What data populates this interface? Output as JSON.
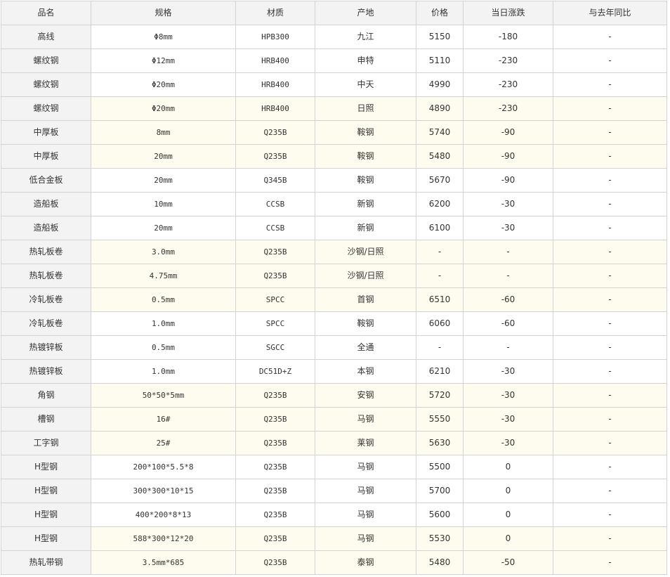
{
  "columns": [
    "品名",
    "规格",
    "材质",
    "产地",
    "价格",
    "当日涨跌",
    "与去年同比"
  ],
  "rows": [
    {
      "name": "高线",
      "spec": "Φ8mm",
      "material": "HPB300",
      "origin": "九江",
      "price": "5150",
      "change": "-180",
      "yoy": "-",
      "highlight": false
    },
    {
      "name": "螺纹钢",
      "spec": "Φ12mm",
      "material": "HRB400",
      "origin": "申特",
      "price": "5110",
      "change": "-230",
      "yoy": "-",
      "highlight": false
    },
    {
      "name": "螺纹钢",
      "spec": "Φ20mm",
      "material": "HRB400",
      "origin": "中天",
      "price": "4990",
      "change": "-230",
      "yoy": "-",
      "highlight": false
    },
    {
      "name": "螺纹钢",
      "spec": "Φ20mm",
      "material": "HRB400",
      "origin": "日照",
      "price": "4890",
      "change": "-230",
      "yoy": "-",
      "highlight": true
    },
    {
      "name": "中厚板",
      "spec": "8mm",
      "material": "Q235B",
      "origin": "鞍钢",
      "price": "5740",
      "change": "-90",
      "yoy": "-",
      "highlight": true
    },
    {
      "name": "中厚板",
      "spec": "20mm",
      "material": "Q235B",
      "origin": "鞍钢",
      "price": "5480",
      "change": "-90",
      "yoy": "-",
      "highlight": true
    },
    {
      "name": "低合金板",
      "spec": "20mm",
      "material": "Q345B",
      "origin": "鞍钢",
      "price": "5670",
      "change": "-90",
      "yoy": "-",
      "highlight": false
    },
    {
      "name": "造船板",
      "spec": "10mm",
      "material": "CCSB",
      "origin": "新钢",
      "price": "6200",
      "change": "-30",
      "yoy": "-",
      "highlight": false
    },
    {
      "name": "造船板",
      "spec": "20mm",
      "material": "CCSB",
      "origin": "新钢",
      "price": "6100",
      "change": "-30",
      "yoy": "-",
      "highlight": false
    },
    {
      "name": "热轧板卷",
      "spec": "3.0mm",
      "material": "Q235B",
      "origin": "沙钢/日照",
      "price": "-",
      "change": "-",
      "yoy": "-",
      "highlight": true
    },
    {
      "name": "热轧板卷",
      "spec": "4.75mm",
      "material": "Q235B",
      "origin": "沙钢/日照",
      "price": "-",
      "change": "-",
      "yoy": "-",
      "highlight": true
    },
    {
      "name": "冷轧板卷",
      "spec": "0.5mm",
      "material": "SPCC",
      "origin": "首钢",
      "price": "6510",
      "change": "-60",
      "yoy": "-",
      "highlight": true
    },
    {
      "name": "冷轧板卷",
      "spec": "1.0mm",
      "material": "SPCC",
      "origin": "鞍钢",
      "price": "6060",
      "change": "-60",
      "yoy": "-",
      "highlight": false
    },
    {
      "name": "热镀锌板",
      "spec": "0.5mm",
      "material": "SGCC",
      "origin": "全通",
      "price": "-",
      "change": "-",
      "yoy": "-",
      "highlight": false
    },
    {
      "name": "热镀锌板",
      "spec": "1.0mm",
      "material": "DC51D+Z",
      "origin": "本钢",
      "price": "6210",
      "change": "-30",
      "yoy": "-",
      "highlight": false
    },
    {
      "name": "角钢",
      "spec": "50*50*5mm",
      "material": "Q235B",
      "origin": "安钢",
      "price": "5720",
      "change": "-30",
      "yoy": "-",
      "highlight": true
    },
    {
      "name": "槽钢",
      "spec": "16#",
      "material": "Q235B",
      "origin": "马钢",
      "price": "5550",
      "change": "-30",
      "yoy": "-",
      "highlight": true
    },
    {
      "name": "工字钢",
      "spec": "25#",
      "material": "Q235B",
      "origin": "莱钢",
      "price": "5630",
      "change": "-30",
      "yoy": "-",
      "highlight": true
    },
    {
      "name": "H型钢",
      "spec": "200*100*5.5*8",
      "material": "Q235B",
      "origin": "马钢",
      "price": "5500",
      "change": "0",
      "yoy": "-",
      "highlight": false
    },
    {
      "name": "H型钢",
      "spec": "300*300*10*15",
      "material": "Q235B",
      "origin": "马钢",
      "price": "5700",
      "change": "0",
      "yoy": "-",
      "highlight": false
    },
    {
      "name": "H型钢",
      "spec": "400*200*8*13",
      "material": "Q235B",
      "origin": "马钢",
      "price": "5600",
      "change": "0",
      "yoy": "-",
      "highlight": false
    },
    {
      "name": "H型钢",
      "spec": "588*300*12*20",
      "material": "Q235B",
      "origin": "马钢",
      "price": "5530",
      "change": "0",
      "yoy": "-",
      "highlight": true
    },
    {
      "name": "热轧带钢",
      "spec": "3.5mm*685",
      "material": "Q235B",
      "origin": "泰钢",
      "price": "5480",
      "change": "-50",
      "yoy": "-",
      "highlight": true
    }
  ],
  "colors": {
    "header_bg": "#f3f3f3",
    "highlight_bg": "#fdfcee",
    "border": "#d3d3d3"
  }
}
